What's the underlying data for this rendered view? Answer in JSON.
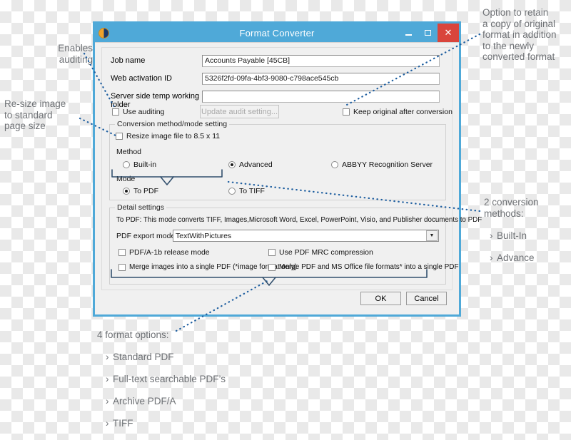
{
  "window": {
    "title": "Format Converter",
    "icon": "app-circle-icon",
    "accent": "#4fa9d8",
    "close_color": "#d9453c",
    "buttons": {
      "minimize": "–",
      "maximize": "▭",
      "close": "×"
    }
  },
  "form": {
    "job_name": {
      "label": "Job name",
      "value": "Accounts Payable [45CB]"
    },
    "web_activation_id": {
      "label": "Web activation ID",
      "value": "5326f2fd-09fa-4bf3-9080-c798ace545cb"
    },
    "temp_folder": {
      "label": "Server side temp working folder",
      "value": "",
      "placeholder": ""
    },
    "use_auditing": {
      "label": "Use auditing",
      "checked": false
    },
    "update_audit_button": {
      "label": "Update audit setting...",
      "enabled": false
    },
    "keep_original": {
      "label": "Keep original after conversion",
      "checked": false
    }
  },
  "conversion": {
    "caption": "Conversion method/mode setting",
    "resize": {
      "label": "Resize image file to 8.5 x 11",
      "checked": false
    },
    "method_label": "Method",
    "methods": [
      {
        "label": "Built-in",
        "selected": false
      },
      {
        "label": "Advanced",
        "selected": true
      },
      {
        "label": "ABBYY Recognition Server",
        "selected": false
      }
    ],
    "mode_label": "Mode",
    "modes": [
      {
        "label": "To PDF",
        "selected": true
      },
      {
        "label": "To TIFF",
        "selected": false
      }
    ]
  },
  "detail": {
    "caption": "Detail settings",
    "description": "To PDF: This mode converts TIFF, Images,Microsoft Word, Excel, PowerPoint, Visio, and Publisher documents to PDF",
    "export_mode": {
      "label": "PDF export mode",
      "value": "TextWithPictures"
    },
    "checkboxes": [
      {
        "label": "PDF/A-1b release mode",
        "checked": false
      },
      {
        "label": "Use PDF MRC compression",
        "checked": false
      },
      {
        "label": "Merge images into a single PDF (*image format only)",
        "checked": false
      },
      {
        "label": "Merge PDF and MS Office file formats* into a single PDF",
        "checked": false
      }
    ]
  },
  "footer": {
    "ok": "OK",
    "cancel": "Cancel"
  },
  "annotations": {
    "enables_auditing": "Enables\nauditing",
    "resize_image": "Re-size image\nto standard\npage size",
    "keep_original": "Option to retain\na copy of original\nformat in addition\nto the newly\nconverted format",
    "conversion_methods_title": "2 conversion",
    "conversion_methods_sub": "methods:",
    "conversion_methods_items": [
      "Built-In",
      "Advance"
    ],
    "format_options_title": "4 format options:",
    "format_options_items": [
      "Standard PDF",
      "Full-text searchable PDF’s",
      "Archive PDF/A",
      "TIFF"
    ]
  }
}
